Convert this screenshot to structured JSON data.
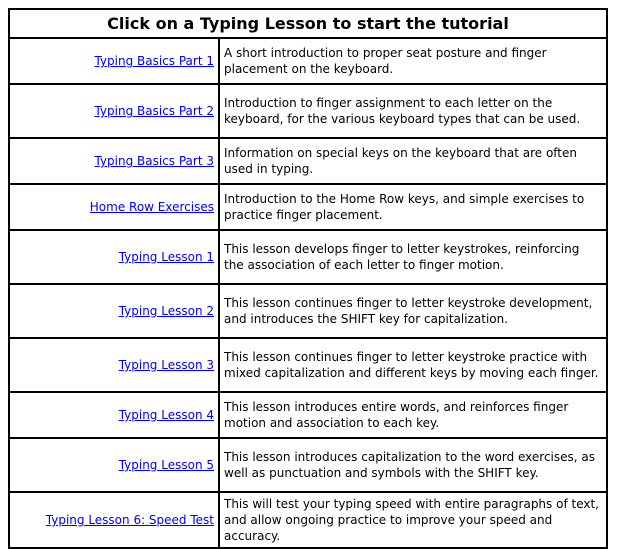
{
  "title": "Click on a Typing Lesson to start the tutorial",
  "colors": {
    "link": "#0000ee",
    "border": "#000000",
    "text": "#000000"
  },
  "lessons": [
    {
      "link": "Typing Basics Part 1",
      "description": "A short introduction to proper seat posture and finger placement on the keyboard."
    },
    {
      "link": "Typing Basics Part 2",
      "description": "Introduction to finger assignment to each letter on the keyboard, for the various keyboard types that can be used."
    },
    {
      "link": "Typing Basics Part 3",
      "description": "Information on special keys on the keyboard that are often used in typing."
    },
    {
      "link": "Home Row Exercises",
      "description": "Introduction to the Home Row keys, and simple exercises to practice finger placement."
    },
    {
      "link": "Typing Lesson 1",
      "description": "This lesson develops finger to letter keystrokes, reinforcing the association of each letter to finger motion."
    },
    {
      "link": "Typing Lesson 2",
      "description": "This lesson continues finger to letter keystroke development, and introduces the SHIFT key for capitalization."
    },
    {
      "link": "Typing Lesson 3",
      "description": "This lesson continues finger to letter keystroke practice with mixed capitalization and different keys by moving each finger."
    },
    {
      "link": "Typing Lesson 4",
      "description": "This lesson introduces entire words, and reinforces finger motion and association to each key."
    },
    {
      "link": "Typing Lesson 5",
      "description": "This lesson introduces capitalization to the word exercises, as well as punctuation and symbols with the SHIFT key."
    },
    {
      "link": "Typing Lesson 6: Speed Test",
      "description": "This will test your typing speed with entire paragraphs of text, and allow ongoing practice to improve your speed and accuracy."
    }
  ]
}
